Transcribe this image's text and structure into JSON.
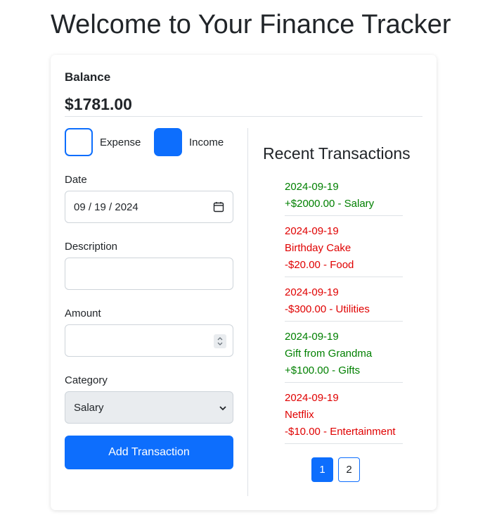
{
  "page": {
    "title": "Welcome to Your Finance Tracker"
  },
  "balance": {
    "label": "Balance",
    "value": "$1781.00"
  },
  "type_toggle": {
    "expense_label": "Expense",
    "income_label": "Income",
    "selected": "Income"
  },
  "form": {
    "date": {
      "label": "Date",
      "value": "09 / 19 / 2024"
    },
    "description": {
      "label": "Description",
      "value": ""
    },
    "amount": {
      "label": "Amount",
      "value": ""
    },
    "category": {
      "label": "Category",
      "value": "Salary"
    },
    "submit_label": "Add Transaction"
  },
  "recent": {
    "title": "Recent Transactions",
    "items": [
      {
        "type": "income",
        "lines": [
          "2024-09-19",
          "+$2000.00 - Salary"
        ]
      },
      {
        "type": "expense",
        "lines": [
          "2024-09-19",
          "Birthday Cake",
          "-$20.00 - Food"
        ]
      },
      {
        "type": "expense",
        "lines": [
          "2024-09-19",
          "-$300.00 - Utilities"
        ]
      },
      {
        "type": "income",
        "lines": [
          "2024-09-19",
          "Gift from Grandma",
          "+$100.00 - Gifts"
        ]
      },
      {
        "type": "expense",
        "lines": [
          "2024-09-19",
          "Netflix",
          "-$10.00 - Entertainment"
        ]
      }
    ]
  },
  "pagination": {
    "pages": [
      "1",
      "2"
    ],
    "current": "1"
  },
  "colors": {
    "primary": "#0d6efd",
    "income": "#008000",
    "expense": "#e00000"
  },
  "icons": {
    "date": "calendar-icon",
    "amount": "spinner-icon",
    "category": "chevron-down-icon"
  }
}
